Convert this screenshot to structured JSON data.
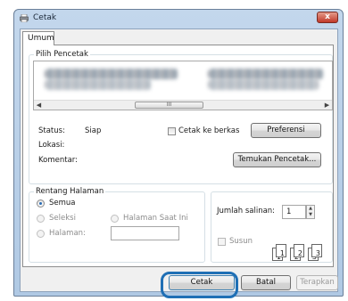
{
  "window": {
    "title": "Cetak",
    "close_label": "x"
  },
  "tabs": [
    {
      "label": "Umum"
    }
  ],
  "printer_group": {
    "title": "Pilih Pencetak",
    "scroll_left": "◀",
    "scroll_right": "▶",
    "scroll_thumb": "III",
    "status_label": "Status:",
    "status_value": "Siap",
    "location_label": "Lokasi:",
    "comment_label": "Komentar:",
    "print_to_file_label": "Cetak ke berkas",
    "preferences_button": "Preferensi",
    "find_printer_button": "Temukan Pencetak..."
  },
  "range_group": {
    "title": "Rentang Halaman",
    "options": [
      "Semua",
      "Seleksi",
      "Halaman Saat Ini",
      "Halaman:"
    ],
    "selected": "Semua"
  },
  "copies_group": {
    "copies_label": "Jumlah salinan:",
    "copies_value": "1",
    "collate_label": "Susun",
    "collate_pages": [
      "1",
      "1",
      "2",
      "2",
      "3",
      "3"
    ]
  },
  "footer": {
    "print_button": "Cetak",
    "cancel_button": "Batal",
    "apply_button": "Terapkan"
  },
  "colors": {
    "highlight_ring": "#1f6fb5",
    "radio_accent": "#2a6db5"
  }
}
